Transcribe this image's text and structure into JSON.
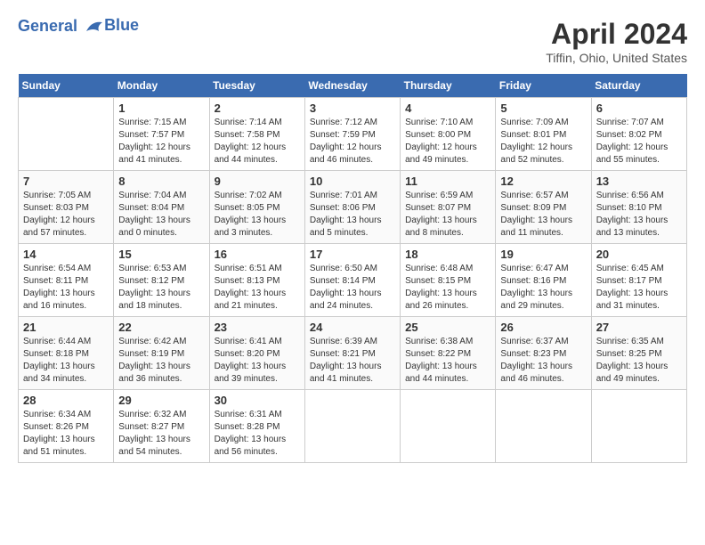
{
  "header": {
    "logo_line1": "General",
    "logo_line2": "Blue",
    "title": "April 2024",
    "location": "Tiffin, Ohio, United States"
  },
  "days_of_week": [
    "Sunday",
    "Monday",
    "Tuesday",
    "Wednesday",
    "Thursday",
    "Friday",
    "Saturday"
  ],
  "weeks": [
    [
      {
        "day": "",
        "info": ""
      },
      {
        "day": "1",
        "info": "Sunrise: 7:15 AM\nSunset: 7:57 PM\nDaylight: 12 hours\nand 41 minutes."
      },
      {
        "day": "2",
        "info": "Sunrise: 7:14 AM\nSunset: 7:58 PM\nDaylight: 12 hours\nand 44 minutes."
      },
      {
        "day": "3",
        "info": "Sunrise: 7:12 AM\nSunset: 7:59 PM\nDaylight: 12 hours\nand 46 minutes."
      },
      {
        "day": "4",
        "info": "Sunrise: 7:10 AM\nSunset: 8:00 PM\nDaylight: 12 hours\nand 49 minutes."
      },
      {
        "day": "5",
        "info": "Sunrise: 7:09 AM\nSunset: 8:01 PM\nDaylight: 12 hours\nand 52 minutes."
      },
      {
        "day": "6",
        "info": "Sunrise: 7:07 AM\nSunset: 8:02 PM\nDaylight: 12 hours\nand 55 minutes."
      }
    ],
    [
      {
        "day": "7",
        "info": "Sunrise: 7:05 AM\nSunset: 8:03 PM\nDaylight: 12 hours\nand 57 minutes."
      },
      {
        "day": "8",
        "info": "Sunrise: 7:04 AM\nSunset: 8:04 PM\nDaylight: 13 hours\nand 0 minutes."
      },
      {
        "day": "9",
        "info": "Sunrise: 7:02 AM\nSunset: 8:05 PM\nDaylight: 13 hours\nand 3 minutes."
      },
      {
        "day": "10",
        "info": "Sunrise: 7:01 AM\nSunset: 8:06 PM\nDaylight: 13 hours\nand 5 minutes."
      },
      {
        "day": "11",
        "info": "Sunrise: 6:59 AM\nSunset: 8:07 PM\nDaylight: 13 hours\nand 8 minutes."
      },
      {
        "day": "12",
        "info": "Sunrise: 6:57 AM\nSunset: 8:09 PM\nDaylight: 13 hours\nand 11 minutes."
      },
      {
        "day": "13",
        "info": "Sunrise: 6:56 AM\nSunset: 8:10 PM\nDaylight: 13 hours\nand 13 minutes."
      }
    ],
    [
      {
        "day": "14",
        "info": "Sunrise: 6:54 AM\nSunset: 8:11 PM\nDaylight: 13 hours\nand 16 minutes."
      },
      {
        "day": "15",
        "info": "Sunrise: 6:53 AM\nSunset: 8:12 PM\nDaylight: 13 hours\nand 18 minutes."
      },
      {
        "day": "16",
        "info": "Sunrise: 6:51 AM\nSunset: 8:13 PM\nDaylight: 13 hours\nand 21 minutes."
      },
      {
        "day": "17",
        "info": "Sunrise: 6:50 AM\nSunset: 8:14 PM\nDaylight: 13 hours\nand 24 minutes."
      },
      {
        "day": "18",
        "info": "Sunrise: 6:48 AM\nSunset: 8:15 PM\nDaylight: 13 hours\nand 26 minutes."
      },
      {
        "day": "19",
        "info": "Sunrise: 6:47 AM\nSunset: 8:16 PM\nDaylight: 13 hours\nand 29 minutes."
      },
      {
        "day": "20",
        "info": "Sunrise: 6:45 AM\nSunset: 8:17 PM\nDaylight: 13 hours\nand 31 minutes."
      }
    ],
    [
      {
        "day": "21",
        "info": "Sunrise: 6:44 AM\nSunset: 8:18 PM\nDaylight: 13 hours\nand 34 minutes."
      },
      {
        "day": "22",
        "info": "Sunrise: 6:42 AM\nSunset: 8:19 PM\nDaylight: 13 hours\nand 36 minutes."
      },
      {
        "day": "23",
        "info": "Sunrise: 6:41 AM\nSunset: 8:20 PM\nDaylight: 13 hours\nand 39 minutes."
      },
      {
        "day": "24",
        "info": "Sunrise: 6:39 AM\nSunset: 8:21 PM\nDaylight: 13 hours\nand 41 minutes."
      },
      {
        "day": "25",
        "info": "Sunrise: 6:38 AM\nSunset: 8:22 PM\nDaylight: 13 hours\nand 44 minutes."
      },
      {
        "day": "26",
        "info": "Sunrise: 6:37 AM\nSunset: 8:23 PM\nDaylight: 13 hours\nand 46 minutes."
      },
      {
        "day": "27",
        "info": "Sunrise: 6:35 AM\nSunset: 8:25 PM\nDaylight: 13 hours\nand 49 minutes."
      }
    ],
    [
      {
        "day": "28",
        "info": "Sunrise: 6:34 AM\nSunset: 8:26 PM\nDaylight: 13 hours\nand 51 minutes."
      },
      {
        "day": "29",
        "info": "Sunrise: 6:32 AM\nSunset: 8:27 PM\nDaylight: 13 hours\nand 54 minutes."
      },
      {
        "day": "30",
        "info": "Sunrise: 6:31 AM\nSunset: 8:28 PM\nDaylight: 13 hours\nand 56 minutes."
      },
      {
        "day": "",
        "info": ""
      },
      {
        "day": "",
        "info": ""
      },
      {
        "day": "",
        "info": ""
      },
      {
        "day": "",
        "info": ""
      }
    ]
  ]
}
